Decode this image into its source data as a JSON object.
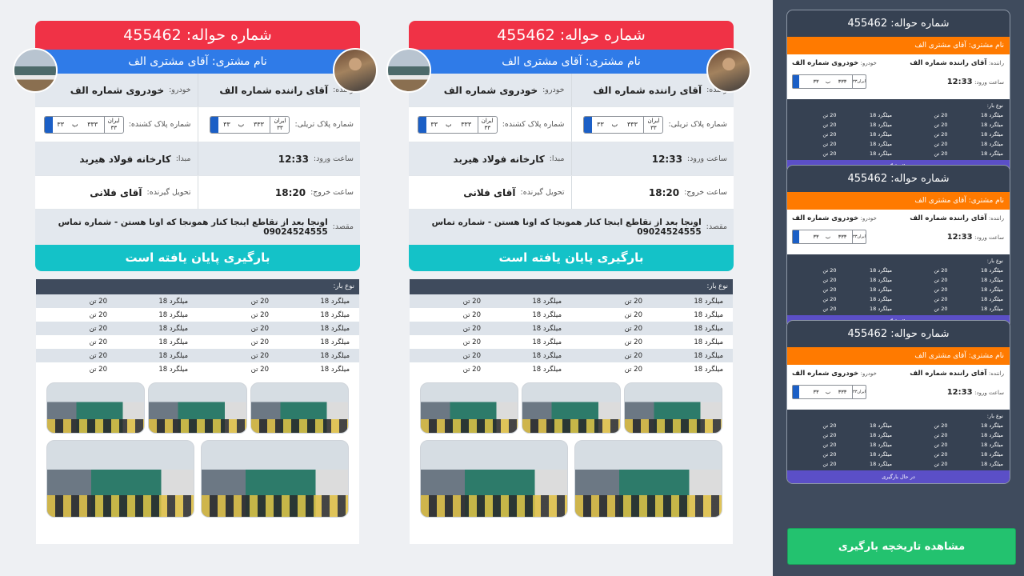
{
  "colors": {
    "header_red": "#f03246",
    "customer_blue": "#2f7be8",
    "status_teal": "#14c2c8",
    "panel_bg": "#3f4b5d",
    "mini_customer_orange": "#ff7a00",
    "mini_status_purple": "#5b4fc7",
    "history_green": "#23c26f"
  },
  "cards": [
    {
      "title": "شماره حواله: 455462",
      "customer": "نام مشتری: آقای مشتری الف",
      "driver_label": "راننده:",
      "driver": "آقای راننده شماره الف",
      "vehicle_label": "خودرو:",
      "vehicle": "خودروی شماره الف",
      "trailer_plate_label": "شماره پلاک تریلی:",
      "tractor_plate_label": "شماره پلاک کشنده:",
      "plate": {
        "iran": "ایران",
        "region": "۳۳",
        "number": "۳۳۳",
        "letter": "ب",
        "prefix": "۳۳"
      },
      "entry_label": "ساعت ورود:",
      "entry_time": "12:33",
      "origin_label": "مبدا:",
      "origin": "کارخانه فولاد هیربد",
      "exit_label": "ساعت خروج:",
      "exit_time": "18:20",
      "receiver_label": "تحویل گیرنده:",
      "receiver": "آقای فلانی",
      "destination_label": "مقصد:",
      "destination": "اونجا بعد از تقاطع اینجا کنار همونجا که اونا هستن - شماره تماس 09024524555",
      "status": "بارگیری پایان یافته است",
      "cargo_header": "نوع بار:",
      "cargo_rows": [
        [
          "میلگرد 18",
          "20 تن",
          "میلگرد 18",
          "20 تن"
        ],
        [
          "میلگرد 18",
          "20 تن",
          "میلگرد 18",
          "20 تن"
        ],
        [
          "میلگرد 18",
          "20 تن",
          "میلگرد 18",
          "20 تن"
        ],
        [
          "میلگرد 18",
          "20 تن",
          "میلگرد 18",
          "20 تن"
        ],
        [
          "میلگرد 18",
          "20 تن",
          "میلگرد 18",
          "20 تن"
        ],
        [
          "میلگرد 18",
          "20 تن",
          "میلگرد 18",
          "20 تن"
        ]
      ]
    },
    {
      "title": "شماره حواله: 455462",
      "customer": "نام مشتری: آقای مشتری الف",
      "driver_label": "راننده:",
      "driver": "آقای راننده شماره الف",
      "vehicle_label": "خودرو:",
      "vehicle": "خودروی شماره الف",
      "trailer_plate_label": "شماره پلاک تریلی:",
      "tractor_plate_label": "شماره پلاک کشنده:",
      "plate": {
        "iran": "ایران",
        "region": "۳۳",
        "number": "۳۳۳",
        "letter": "ب",
        "prefix": "۳۳"
      },
      "entry_label": "ساعت ورود:",
      "entry_time": "12:33",
      "origin_label": "مبدا:",
      "origin": "کارخانه فولاد هیربد",
      "exit_label": "ساعت خروج:",
      "exit_time": "18:20",
      "receiver_label": "تحویل گیرنده:",
      "receiver": "آقای فلانی",
      "destination_label": "مقصد:",
      "destination": "اونجا بعد از تقاطع اینجا کنار همونجا که اونا هستن - شماره تماس 09024524555",
      "status": "بارگیری پایان یافته است",
      "cargo_header": "نوع بار:",
      "cargo_rows": [
        [
          "میلگرد 18",
          "20 تن",
          "میلگرد 18",
          "20 تن"
        ],
        [
          "میلگرد 18",
          "20 تن",
          "میلگرد 18",
          "20 تن"
        ],
        [
          "میلگرد 18",
          "20 تن",
          "میلگرد 18",
          "20 تن"
        ],
        [
          "میلگرد 18",
          "20 تن",
          "میلگرد 18",
          "20 تن"
        ],
        [
          "میلگرد 18",
          "20 تن",
          "میلگرد 18",
          "20 تن"
        ],
        [
          "میلگرد 18",
          "20 تن",
          "میلگرد 18",
          "20 تن"
        ]
      ]
    }
  ],
  "mini_cards": [
    {
      "title": "شماره حواله: 455462",
      "customer": "نام مشتری: آقای مشتری الف",
      "driver_label": "راننده:",
      "driver": "آقای راننده شماره الف",
      "vehicle_label": "خودرو:",
      "vehicle": "خودروی شماره الف",
      "entry_label": "ساعت ورود:",
      "entry_time": "12:33",
      "plate": {
        "iran": "ایران",
        "region": "۳۳",
        "number": "۳۳۳",
        "letter": "ب",
        "prefix": "۳۳"
      },
      "cargo_header": "نوع بار:",
      "cargo_rows": [
        [
          "میلگرد 18",
          "20 تن",
          "میلگرد 18",
          "20 تن"
        ],
        [
          "میلگرد 18",
          "20 تن",
          "میلگرد 18",
          "20 تن"
        ],
        [
          "میلگرد 18",
          "20 تن",
          "میلگرد 18",
          "20 تن"
        ],
        [
          "میلگرد 18",
          "20 تن",
          "میلگرد 18",
          "20 تن"
        ],
        [
          "میلگرد 18",
          "20 تن",
          "میلگرد 18",
          "20 تن"
        ]
      ],
      "status": "در حال بارگیری"
    },
    {
      "title": "شماره حواله: 455462",
      "customer": "نام مشتری: آقای مشتری الف",
      "driver_label": "راننده:",
      "driver": "آقای راننده شماره الف",
      "vehicle_label": "خودرو:",
      "vehicle": "خودروی شماره الف",
      "entry_label": "ساعت ورود:",
      "entry_time": "12:33",
      "plate": {
        "iran": "ایران",
        "region": "۳۳",
        "number": "۳۳۳",
        "letter": "ب",
        "prefix": "۳۳"
      },
      "cargo_header": "نوع بار:",
      "cargo_rows": [
        [
          "میلگرد 18",
          "20 تن",
          "میلگرد 18",
          "20 تن"
        ],
        [
          "میلگرد 18",
          "20 تن",
          "میلگرد 18",
          "20 تن"
        ],
        [
          "میلگرد 18",
          "20 تن",
          "میلگرد 18",
          "20 تن"
        ],
        [
          "میلگرد 18",
          "20 تن",
          "میلگرد 18",
          "20 تن"
        ],
        [
          "میلگرد 18",
          "20 تن",
          "میلگرد 18",
          "20 تن"
        ]
      ],
      "status": "در حال بارگیری"
    },
    {
      "title": "شماره حواله: 455462",
      "customer": "نام مشتری: آقای مشتری الف",
      "driver_label": "راننده:",
      "driver": "آقای راننده شماره الف",
      "vehicle_label": "خودرو:",
      "vehicle": "خودروی شماره الف",
      "entry_label": "ساعت ورود:",
      "entry_time": "12:33",
      "plate": {
        "iran": "ایران",
        "region": "۳۳",
        "number": "۳۳۳",
        "letter": "ب",
        "prefix": "۳۳"
      },
      "cargo_header": "نوع بار:",
      "cargo_rows": [
        [
          "میلگرد 18",
          "20 تن",
          "میلگرد 18",
          "20 تن"
        ],
        [
          "میلگرد 18",
          "20 تن",
          "میلگرد 18",
          "20 تن"
        ],
        [
          "میلگرد 18",
          "20 تن",
          "میلگرد 18",
          "20 تن"
        ],
        [
          "میلگرد 18",
          "20 تن",
          "میلگرد 18",
          "20 تن"
        ],
        [
          "میلگرد 18",
          "20 تن",
          "میلگرد 18",
          "20 تن"
        ]
      ],
      "status": "در حال بارگیری"
    }
  ],
  "history_button": "مشاهده تاریخچه بارگیری"
}
